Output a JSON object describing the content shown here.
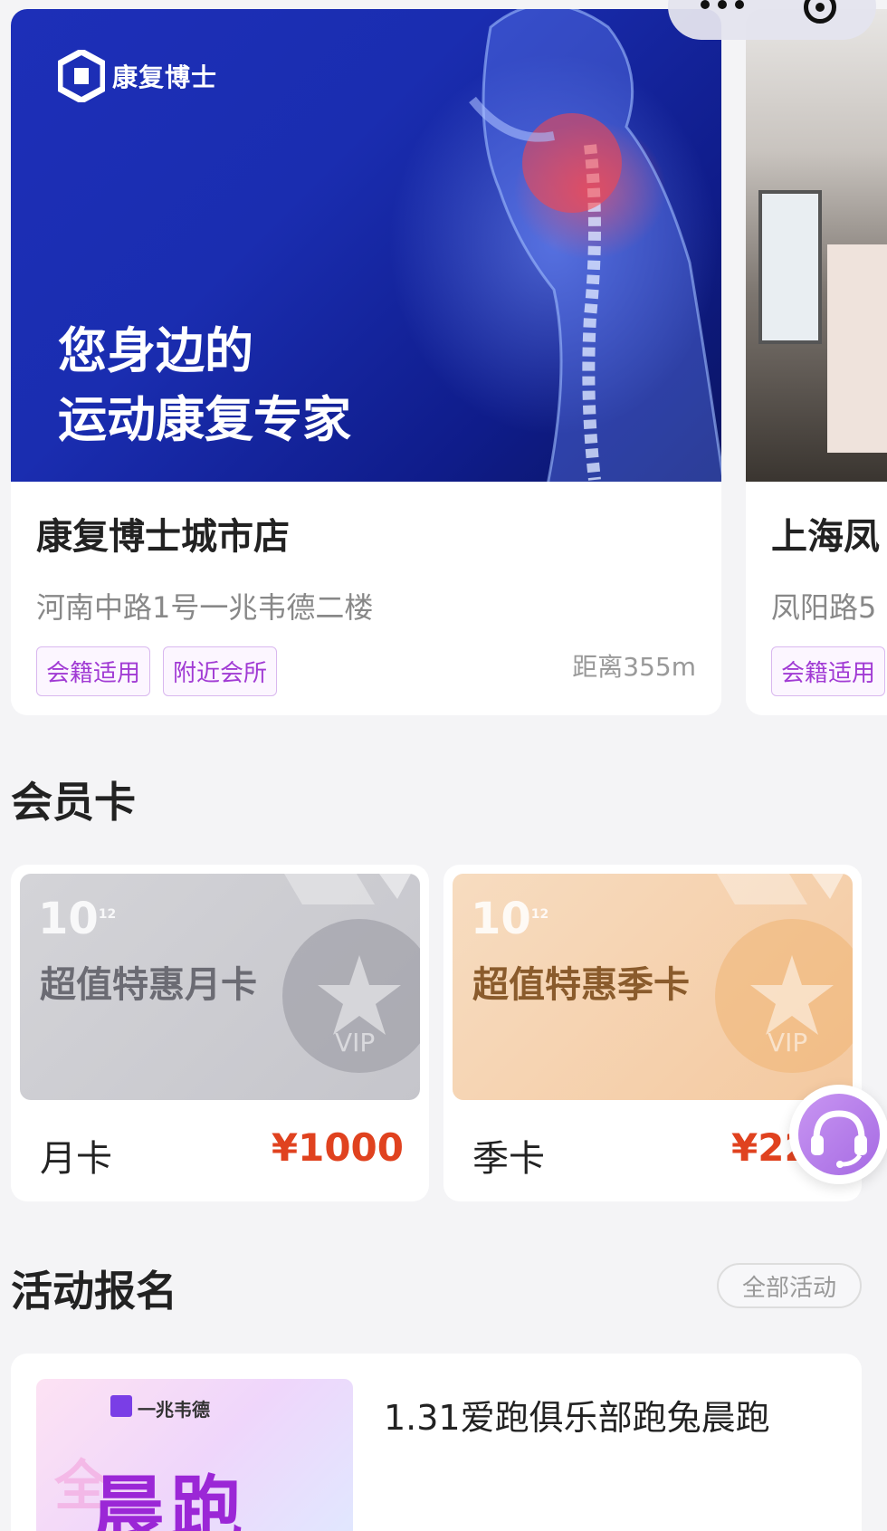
{
  "store_carousel": {
    "main": {
      "brand_name": "康复博士",
      "slogan_line1": "您身边的",
      "slogan_line2": "运动康复专家",
      "name": "康复博士城市店",
      "address": "河南中路1号一兆韦德二楼",
      "tags": [
        "会籍适用",
        "附近会所"
      ],
      "distance": "距离355m"
    },
    "peek": {
      "name": "上海凤",
      "address": "凤阳路5",
      "tag": "会籍适用"
    }
  },
  "membership": {
    "section_title": "会员卡",
    "cards": [
      {
        "logo": "10",
        "title": "超值特惠月卡",
        "vip": "VIP",
        "name": "月卡",
        "price": "¥1000"
      },
      {
        "logo": "10",
        "title": "超值特惠季卡",
        "vip": "VIP",
        "name": "季卡",
        "price": "¥22"
      }
    ]
  },
  "activities": {
    "section_title": "活动报名",
    "all_label": "全部活动",
    "items": [
      {
        "title": "1.31爱跑俱乐部跑兔晨跑",
        "thumb_brand": "一兆韦德",
        "thumb_word": "晨跑",
        "thumb_ghost": "全"
      }
    ]
  },
  "colors": {
    "accent_purple": "#a13bd4",
    "price_red": "#e0421f",
    "banner_blue": "#1a2db0"
  }
}
